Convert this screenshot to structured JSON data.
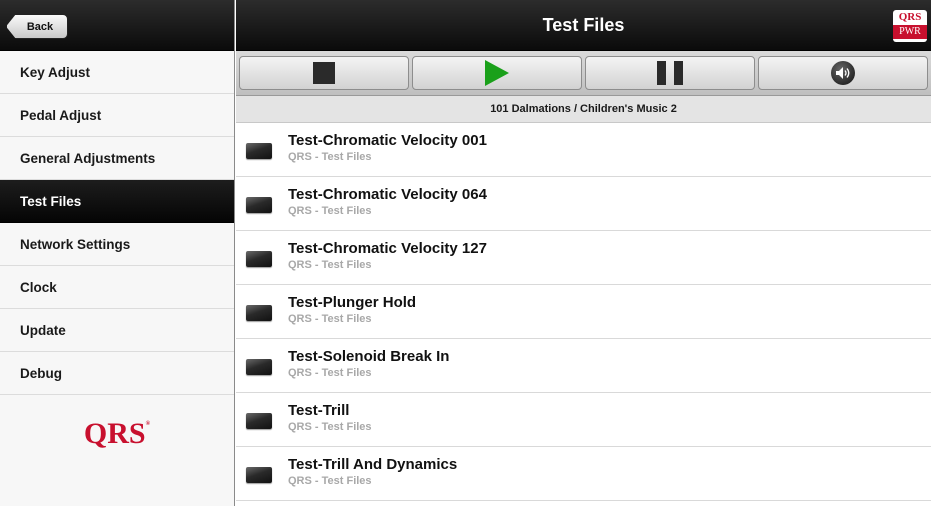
{
  "header": {
    "back_label": "Back",
    "title": "Test Files",
    "logo_line1": "QRS",
    "logo_line2": "PWR"
  },
  "sidebar": {
    "items": [
      {
        "label": "Key Adjust",
        "active": false
      },
      {
        "label": "Pedal Adjust",
        "active": false
      },
      {
        "label": "General Adjustments",
        "active": false
      },
      {
        "label": "Test Files",
        "active": true
      },
      {
        "label": "Network Settings",
        "active": false
      },
      {
        "label": "Clock",
        "active": false
      },
      {
        "label": "Update",
        "active": false
      },
      {
        "label": "Debug",
        "active": false
      }
    ],
    "logo_text": "QRS",
    "logo_mark": "®"
  },
  "controls": {
    "stop_icon": "stop-icon",
    "play_icon": "play-icon",
    "pause_icon": "pause-icon",
    "volume_icon": "volume-icon",
    "play_color": "#1aa01a"
  },
  "now_playing": "101 Dalmations / Children's Music 2",
  "files": [
    {
      "title": "Test-Chromatic Velocity 001",
      "subtitle": "QRS - Test Files"
    },
    {
      "title": "Test-Chromatic Velocity 064",
      "subtitle": "QRS - Test Files"
    },
    {
      "title": "Test-Chromatic Velocity 127",
      "subtitle": "QRS - Test Files"
    },
    {
      "title": "Test-Plunger Hold",
      "subtitle": "QRS - Test Files"
    },
    {
      "title": "Test-Solenoid Break In",
      "subtitle": "QRS - Test Files"
    },
    {
      "title": "Test-Trill",
      "subtitle": "QRS - Test Files"
    },
    {
      "title": "Test-Trill And Dynamics",
      "subtitle": "QRS - Test Files"
    }
  ]
}
